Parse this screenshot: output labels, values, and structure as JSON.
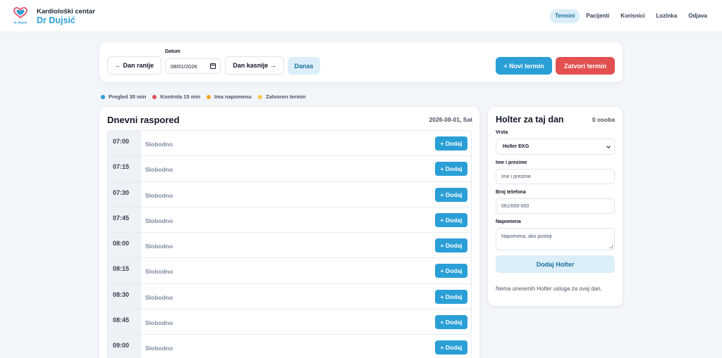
{
  "header": {
    "brand_line1": "Kardiološki centar",
    "brand_line2": "Dr Dujsić",
    "logo_text": "dr dujsić",
    "nav": [
      {
        "label": "Termini",
        "active": true
      },
      {
        "label": "Pacijenti",
        "active": false
      },
      {
        "label": "Korisnici",
        "active": false
      },
      {
        "label": "Lozinka",
        "active": false
      },
      {
        "label": "Odjava",
        "active": false
      }
    ]
  },
  "toolbar": {
    "prev_day": "← Dan ranije",
    "date_label": "Datum",
    "date_value": "08/01/2026",
    "next_day": "Dan kasnije →",
    "today": "Danas",
    "new_appointment": "+ Novi termin",
    "close_appointment": "Zatvori termin"
  },
  "legend": [
    {
      "label": "Pregled 30 min",
      "color": "#2a9fd6"
    },
    {
      "label": "Kontrola 15 min",
      "color": "#e25050"
    },
    {
      "label": "Ima napomenu",
      "color": "#f5a623"
    },
    {
      "label": "Zatvoren termin",
      "color": "#f2c94c"
    }
  ],
  "schedule": {
    "title": "Dnevni raspored",
    "date": "2026-08-01, Sat",
    "slots": [
      {
        "time": "07:00",
        "status": "Slobodno",
        "action": "+ Dodaj"
      },
      {
        "time": "07:15",
        "status": "Slobodno",
        "action": "+ Dodaj"
      },
      {
        "time": "07:30",
        "status": "Slobodno",
        "action": "+ Dodaj"
      },
      {
        "time": "07:45",
        "status": "Slobodno",
        "action": "+ Dodaj"
      },
      {
        "time": "08:00",
        "status": "Slobodno",
        "action": "+ Dodaj"
      },
      {
        "time": "08:15",
        "status": "Slobodno",
        "action": "+ Dodaj"
      },
      {
        "time": "08:30",
        "status": "Slobodno",
        "action": "+ Dodaj"
      },
      {
        "time": "08:45",
        "status": "Slobodno",
        "action": "+ Dodaj"
      },
      {
        "time": "09:00",
        "status": "Slobodno",
        "action": "+ Dodaj"
      }
    ]
  },
  "holter": {
    "title": "Holter za taj dan",
    "count": "0 osoba",
    "type_label": "Vrsta",
    "type_value": "Holter EKG",
    "name_label": "Ime i prezime",
    "name_placeholder": "Ime i prezime",
    "phone_label": "Broj telefona",
    "phone_placeholder": "061/000-000",
    "note_label": "Napomena",
    "note_placeholder": "Napomena, ako postoji",
    "submit": "Dodaj Holter",
    "empty": "Nema unesenih Holter usluga za ovaj dan."
  },
  "colors": {
    "accent": "#2a9fd6",
    "danger": "#e25050",
    "accent_soft": "#dbeefa"
  }
}
